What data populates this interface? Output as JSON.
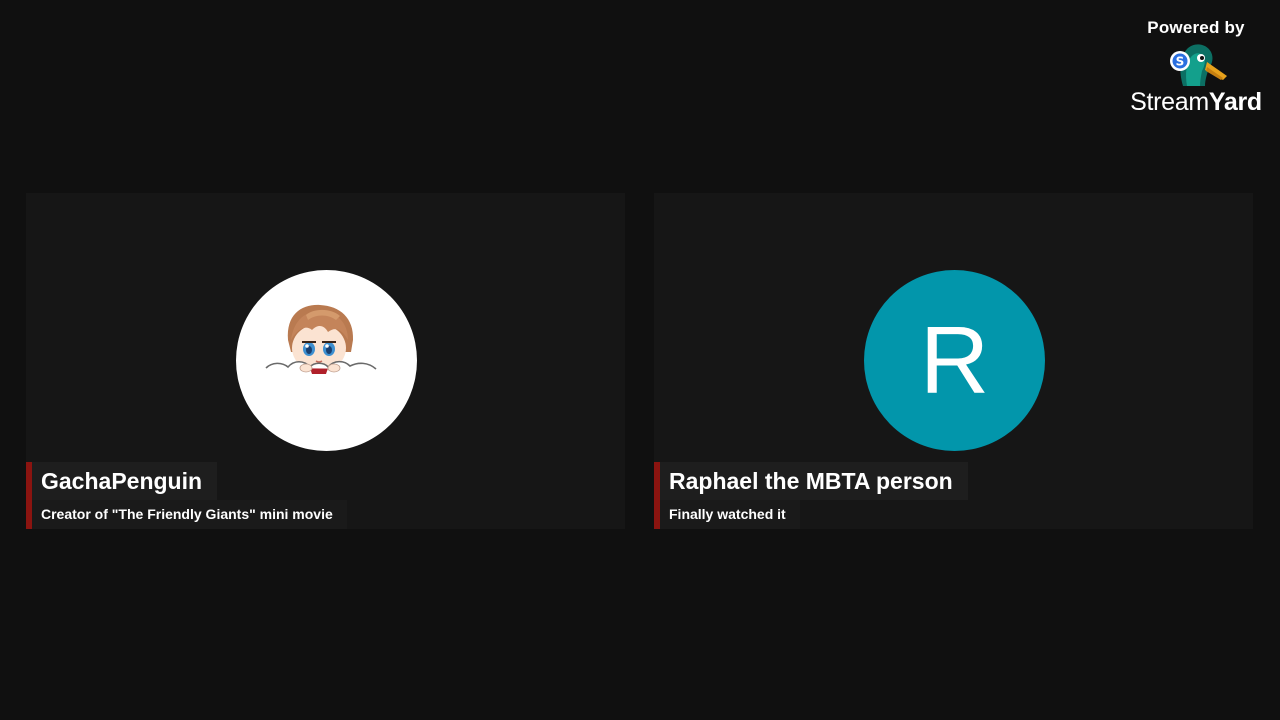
{
  "branding": {
    "powered_by": "Powered by",
    "wordmark_light": "Stream",
    "wordmark_bold": "Yard",
    "mascot_icon": "duck-mascot-icon"
  },
  "participants": [
    {
      "name": "GachaPenguin",
      "caption": "Creator of \"The Friendly Giants\" mini movie",
      "avatar_type": "image",
      "avatar_icon": "anime-character-avatar-icon"
    },
    {
      "name": "Raphael the MBTA person",
      "caption": "Finally watched it",
      "avatar_type": "letter",
      "avatar_letter": "R",
      "avatar_color": "#0296ab"
    }
  ],
  "colors": {
    "background": "#101010",
    "tile": "#161616",
    "accent": "#8b1410"
  }
}
